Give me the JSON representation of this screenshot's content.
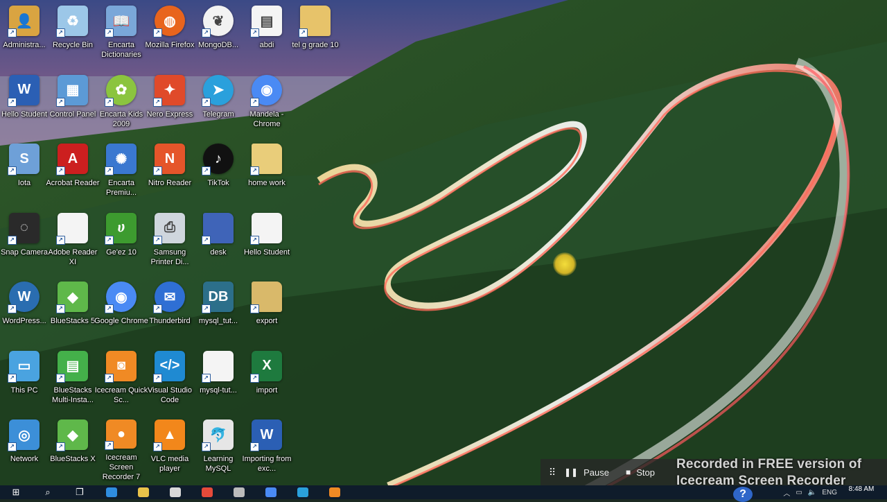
{
  "desktop": {
    "icons": [
      {
        "label": "Administra...",
        "icon": "user-folder-icon",
        "color": "#d9a441"
      },
      {
        "label": "Recycle Bin",
        "icon": "recycle-bin-icon",
        "color": "#9cc7e8"
      },
      {
        "label": "Encarta Dictionaries",
        "icon": "book-icon",
        "color": "#7aa7d9"
      },
      {
        "label": "Mozilla Firefox",
        "icon": "firefox-icon",
        "color": "#e8641d"
      },
      {
        "label": "MongoDB...",
        "icon": "mongodb-leaf-icon",
        "color": "#f2f2f2"
      },
      {
        "label": "abdi",
        "icon": "document-image-icon",
        "color": "#f4f4f4"
      },
      {
        "label": "tel g grade 10",
        "icon": "folder-icon",
        "color": "#e7c36a"
      },
      {
        "label": "Hello Student",
        "icon": "word-doc-icon",
        "color": "#2b5fb4"
      },
      {
        "label": "Control Panel",
        "icon": "control-panel-icon",
        "color": "#5c9ad6"
      },
      {
        "label": "Encarta Kids 2009",
        "icon": "encarta-kids-icon",
        "color": "#8bc43f"
      },
      {
        "label": "Nero Express",
        "icon": "nero-icon",
        "color": "#e04a2a"
      },
      {
        "label": "Telegram",
        "icon": "telegram-icon",
        "color": "#2aa0dc"
      },
      {
        "label": "Mandela - Chrome",
        "icon": "chrome-profile-icon",
        "color": "#4a8af4"
      },
      {
        "label": "Iota",
        "icon": "iota-app-icon",
        "color": "#6ea0d8"
      },
      {
        "label": "Acrobat Reader",
        "icon": "acrobat-icon",
        "color": "#cc1f1f"
      },
      {
        "label": "Encarta Premiu...",
        "icon": "encarta-icon",
        "color": "#3a78d0"
      },
      {
        "label": "Nitro Reader",
        "icon": "nitro-icon",
        "color": "#e5552a"
      },
      {
        "label": "TikTok",
        "icon": "tiktok-icon",
        "color": "#111111"
      },
      {
        "label": "home work",
        "icon": "folder-docs-icon",
        "color": "#e9cd7a"
      },
      {
        "label": "Snap Camera",
        "icon": "snap-camera-icon",
        "color": "#2a2a2a"
      },
      {
        "label": "Adobe Reader XI",
        "icon": "document-icon",
        "color": "#f4f4f4"
      },
      {
        "label": "Ge'ez 10",
        "icon": "geez-icon",
        "color": "#3d9b2f"
      },
      {
        "label": "Samsung Printer Di...",
        "icon": "printer-icon",
        "color": "#cfd6dd"
      },
      {
        "label": "desk",
        "icon": "folder-icon",
        "color": "#3f64b8"
      },
      {
        "label": "Hello Student",
        "icon": "blank-document-icon",
        "color": "#f4f4f4"
      },
      {
        "label": "WordPress...",
        "icon": "wordpress-icon",
        "color": "#2a6db0"
      },
      {
        "label": "BlueStacks 5",
        "icon": "bluestacks-icon",
        "color": "#5fb84a"
      },
      {
        "label": "Google Chrome",
        "icon": "chrome-icon",
        "color": "#4a8af4"
      },
      {
        "label": "Thunderbird",
        "icon": "thunderbird-icon",
        "color": "#2f6fd4"
      },
      {
        "label": "mysql_tut...",
        "icon": "mysql-doc-icon",
        "color": "#2c6f8a"
      },
      {
        "label": "export",
        "icon": "folder-icon",
        "color": "#d9b96a"
      },
      {
        "label": "This PC",
        "icon": "computer-icon",
        "color": "#4aa3e0"
      },
      {
        "label": "BlueStacks Multi-Insta...",
        "icon": "bluestacks-multi-icon",
        "color": "#44b04a"
      },
      {
        "label": "Icecream Quick Sc...",
        "icon": "icecream-camera-icon",
        "color": "#f08a24"
      },
      {
        "label": "Visual Studio Code",
        "icon": "vscode-icon",
        "color": "#1f8ad2"
      },
      {
        "label": "mysql-tut...",
        "icon": "blank-document-icon",
        "color": "#f4f4f4"
      },
      {
        "label": "import",
        "icon": "excel-file-icon",
        "color": "#1e7a3e"
      },
      {
        "label": "Network",
        "icon": "network-icon",
        "color": "#3c8fd8"
      },
      {
        "label": "BlueStacks X",
        "icon": "bluestacks-x-icon",
        "color": "#5fb84a"
      },
      {
        "label": "Icecream Screen Recorder 7",
        "icon": "icecream-recorder-icon",
        "color": "#f08a24"
      },
      {
        "label": "VLC media player",
        "icon": "vlc-cone-icon",
        "color": "#f2871b"
      },
      {
        "label": "Learning MySQL",
        "icon": "mysql-book-icon",
        "color": "#e6e6e6"
      },
      {
        "label": "Importing from exc...",
        "icon": "word-doc-icon",
        "color": "#2b5fb4"
      }
    ]
  },
  "recorder": {
    "pause_label": "Pause",
    "stop_label": "Stop",
    "watermark": "Recorded in FREE version of Icecream Screen Recorder"
  },
  "taskbar": {
    "items": [
      {
        "icon": "windows-start-icon",
        "color": "#ffffff"
      },
      {
        "icon": "search-icon",
        "color": "#ffffff"
      },
      {
        "icon": "task-view-icon",
        "color": "#ffffff"
      },
      {
        "icon": "edge-icon",
        "color": "#2f8de0"
      },
      {
        "icon": "file-explorer-icon",
        "color": "#e9c24a"
      },
      {
        "icon": "store-icon",
        "color": "#d8d8d8"
      },
      {
        "icon": "chrome-icon",
        "color": "#e64a3a"
      },
      {
        "icon": "app-icon",
        "color": "#bbbbbb"
      },
      {
        "icon": "chrome-icon",
        "color": "#4a8af4"
      },
      {
        "icon": "telegram-icon",
        "color": "#2aa0dc"
      },
      {
        "icon": "icecream-icon",
        "color": "#f08a24"
      }
    ],
    "language": "ENG",
    "time": "8:48 AM"
  }
}
